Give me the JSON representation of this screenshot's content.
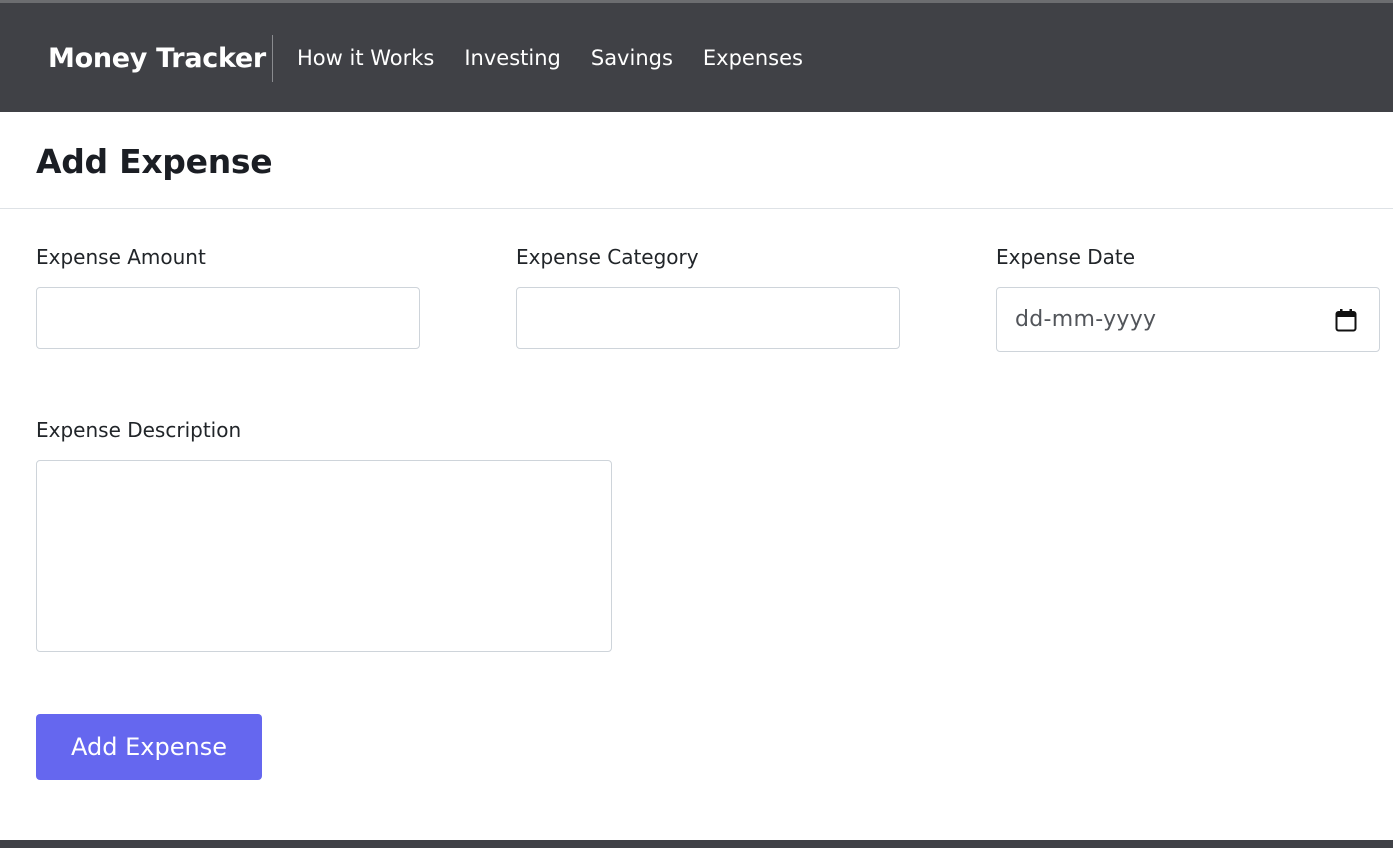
{
  "navbar": {
    "brand": "Money Tracker",
    "links": [
      {
        "label": "How it Works"
      },
      {
        "label": "Investing"
      },
      {
        "label": "Savings"
      },
      {
        "label": "Expenses"
      }
    ]
  },
  "page": {
    "title": "Add Expense"
  },
  "form": {
    "amount": {
      "label": "Expense Amount",
      "value": ""
    },
    "category": {
      "label": "Expense Category",
      "value": ""
    },
    "date": {
      "label": "Expense Date",
      "placeholder": "dd-mm-yyyy",
      "icon": "calendar-icon"
    },
    "description": {
      "label": "Expense Description",
      "value": ""
    },
    "submit_label": "Add Expense"
  },
  "colors": {
    "navbar_bg": "#404146",
    "button_bg": "#6567ef",
    "text": "#212529"
  }
}
